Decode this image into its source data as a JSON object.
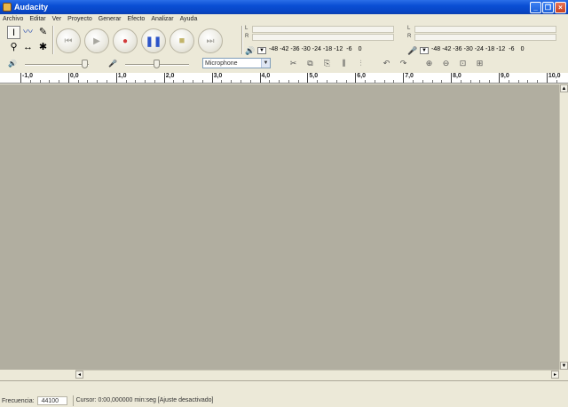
{
  "window": {
    "title": "Audacity",
    "buttons": [
      "_",
      "❐",
      "×"
    ]
  },
  "menu": [
    "Archivo",
    "Editar",
    "Ver",
    "Proyecto",
    "Generar",
    "Efecto",
    "Analizar",
    "Ayuda"
  ],
  "tools": [
    {
      "name": "selection-tool",
      "glyph": "I",
      "selected": true
    },
    {
      "name": "envelope-tool",
      "glyph": "〰"
    },
    {
      "name": "draw-tool",
      "glyph": "✎"
    },
    {
      "name": "zoom-tool",
      "glyph": "⚲"
    },
    {
      "name": "timeshift-tool",
      "glyph": "↔"
    },
    {
      "name": "multi-tool",
      "glyph": "✱"
    }
  ],
  "transport": [
    {
      "name": "skip-start-button",
      "glyph": "⏮"
    },
    {
      "name": "play-button",
      "glyph": "▶"
    },
    {
      "name": "record-button",
      "glyph": "●"
    },
    {
      "name": "pause-button",
      "glyph": "❚❚"
    },
    {
      "name": "stop-button",
      "glyph": "■"
    },
    {
      "name": "skip-end-button",
      "glyph": "⏭"
    }
  ],
  "meters": {
    "channel_left": "L",
    "channel_right": "R",
    "ticks": [
      "-48",
      "-42",
      "-36",
      "-30",
      "-24",
      "-18",
      "-12",
      "-6",
      "0"
    ],
    "playback_icon": "🔊",
    "record_icon": "🎤"
  },
  "mixer": {
    "output_icon": "🔊",
    "input_icon": "🎤",
    "output_level": 0.95,
    "input_level": 0.5,
    "input_source": "Microphone"
  },
  "edit_tools": [
    "✂",
    "⧉",
    "⎘",
    "⫼",
    "⫶",
    "↶",
    "↷",
    "⊕",
    "⊖",
    "⊡",
    "⊞"
  ],
  "ruler": {
    "labels": [
      "-1,0",
      "0,0",
      "1,0",
      "2,0",
      "3,0",
      "4,0",
      "5,0",
      "6,0",
      "7,0",
      "8,0",
      "9,0",
      "10,0"
    ]
  },
  "scroll": {
    "up": "▲",
    "down": "▼",
    "left": "◂",
    "right": "▸"
  },
  "status": {
    "rate_label": "Frecuencia:",
    "rate_value": "44100",
    "cursor_text": "Cursor: 0:00,000000 min:seg  [Ajuste desactivado]"
  }
}
